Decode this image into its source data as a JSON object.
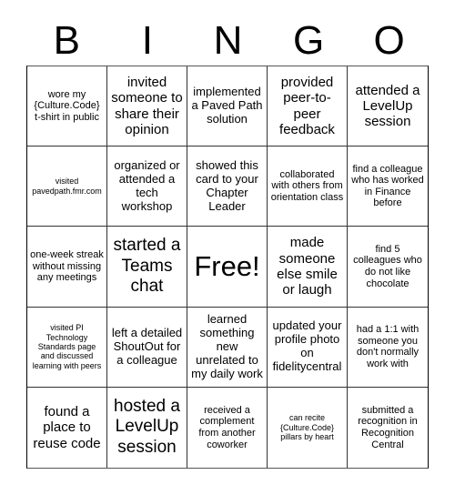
{
  "header": {
    "letters": [
      "B",
      "I",
      "N",
      "G",
      "O"
    ]
  },
  "cells": [
    {
      "text": "wore my {Culture.Code} t-shirt in public",
      "size": "s-sm"
    },
    {
      "text": "invited someone to share their opinion",
      "size": "s-lg"
    },
    {
      "text": "implemented a Paved Path solution",
      "size": "s-md"
    },
    {
      "text": "provided peer-to-peer feedback",
      "size": "s-lg"
    },
    {
      "text": "attended a LevelUp session",
      "size": "s-lg"
    },
    {
      "text": "visited pavedpath.fmr.com",
      "size": "s-xs"
    },
    {
      "text": "organized or attended a tech workshop",
      "size": "s-md"
    },
    {
      "text": "showed this card to your Chapter Leader",
      "size": "s-md"
    },
    {
      "text": "collaborated with others from orientation class",
      "size": "s-sm"
    },
    {
      "text": "find a colleague who has worked in Finance before",
      "size": "s-sm"
    },
    {
      "text": "one-week streak without missing any meetings",
      "size": "s-sm"
    },
    {
      "text": "started a Teams chat",
      "size": "s-xl"
    },
    {
      "text": "Free!",
      "size": "s-free"
    },
    {
      "text": "made someone else smile or laugh",
      "size": "s-lg"
    },
    {
      "text": "find 5 colleagues who do not like chocolate",
      "size": "s-sm"
    },
    {
      "text": "visited PI Technology Standards page and discussed learning with peers",
      "size": "s-xs"
    },
    {
      "text": "left a detailed ShoutOut for a colleague",
      "size": "s-md"
    },
    {
      "text": "learned something new unrelated to my daily work",
      "size": "s-md"
    },
    {
      "text": "updated your profile photo on fidelitycentral",
      "size": "s-md"
    },
    {
      "text": "had a 1:1 with someone you don't normally work with",
      "size": "s-sm"
    },
    {
      "text": "found a place to reuse code",
      "size": "s-lg"
    },
    {
      "text": "hosted a LevelUp session",
      "size": "s-xl"
    },
    {
      "text": "received a complement from another coworker",
      "size": "s-sm"
    },
    {
      "text": "can recite {Culture.Code} pillars by heart",
      "size": "s-xs"
    },
    {
      "text": "submitted a recognition in Recognition Central",
      "size": "s-sm"
    }
  ]
}
